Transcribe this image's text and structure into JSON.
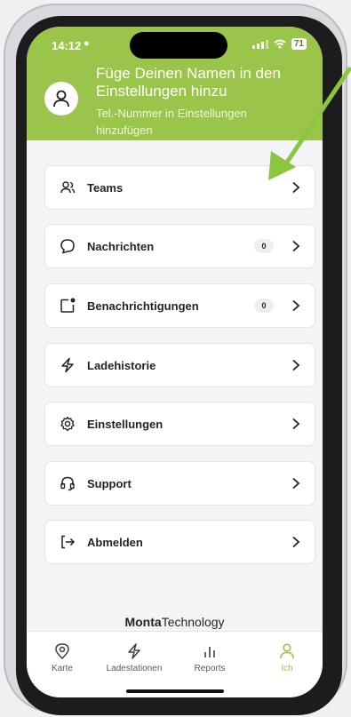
{
  "status": {
    "time": "14:12",
    "battery": "71"
  },
  "profile": {
    "title": "Füge Deinen Namen in den Einstellungen hinzu",
    "subtitle": "Tel.-Nummer in Einstellungen hinzufügen"
  },
  "menu": {
    "items": [
      {
        "label": "Teams",
        "icon": "people-icon"
      },
      {
        "label": "Nachrichten",
        "icon": "chat-bubble-icon",
        "badge": "0"
      },
      {
        "label": "Benachrichtigungen",
        "icon": "notification-icon",
        "badge": "0"
      },
      {
        "label": "Ladehistorie",
        "icon": "lightning-icon"
      },
      {
        "label": "Einstellungen",
        "icon": "gear-icon"
      },
      {
        "label": "Support",
        "icon": "headset-icon"
      },
      {
        "label": "Abmelden",
        "icon": "logout-icon"
      }
    ]
  },
  "brand": {
    "bold": "Monta",
    "rest": "Technology"
  },
  "tabbar": {
    "tabs": [
      {
        "label": "Karte",
        "icon": "map-pin-icon"
      },
      {
        "label": "Ladestationen",
        "icon": "lightning-icon"
      },
      {
        "label": "Reports",
        "icon": "bar-chart-icon"
      },
      {
        "label": "Ich",
        "icon": "person-icon",
        "active": true
      }
    ]
  },
  "colors": {
    "accent": "#9bc44a",
    "arrow": "#8cc63f"
  }
}
